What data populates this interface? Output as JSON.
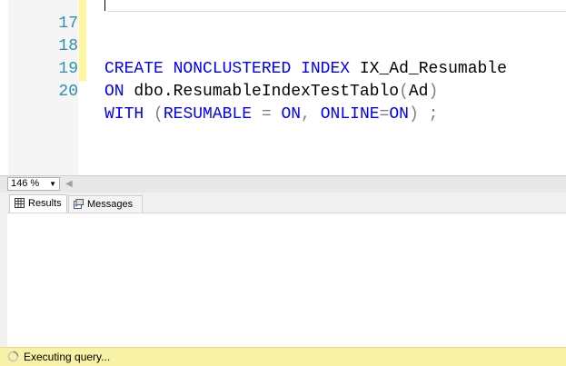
{
  "editor": {
    "lines": [
      {
        "number": "17",
        "tokens": []
      },
      {
        "number": "18",
        "tokens": [
          {
            "t": "CREATE",
            "c": "kw"
          },
          {
            "t": " ",
            "c": "ident"
          },
          {
            "t": "NONCLUSTERED",
            "c": "kw"
          },
          {
            "t": " ",
            "c": "ident"
          },
          {
            "t": "INDEX",
            "c": "kw"
          },
          {
            "t": " IX_Ad_Resumable",
            "c": "ident"
          }
        ]
      },
      {
        "number": "19",
        "tokens": [
          {
            "t": "ON",
            "c": "kw"
          },
          {
            "t": " dbo.ResumableIndexTestTablo",
            "c": "ident"
          },
          {
            "t": "(",
            "c": "op"
          },
          {
            "t": "Ad",
            "c": "ident"
          },
          {
            "t": ")",
            "c": "op"
          }
        ]
      },
      {
        "number": "20",
        "tokens": [
          {
            "t": "WITH",
            "c": "kw"
          },
          {
            "t": " ",
            "c": "ident"
          },
          {
            "t": "(",
            "c": "op"
          },
          {
            "t": "RESUMABLE",
            "c": "kw"
          },
          {
            "t": " ",
            "c": "ident"
          },
          {
            "t": "=",
            "c": "op"
          },
          {
            "t": " ",
            "c": "ident"
          },
          {
            "t": "ON",
            "c": "kw"
          },
          {
            "t": ",",
            "c": "op"
          },
          {
            "t": " ",
            "c": "ident"
          },
          {
            "t": "ONLINE",
            "c": "kw"
          },
          {
            "t": "=",
            "c": "op"
          },
          {
            "t": "ON",
            "c": "kw"
          },
          {
            "t": ")",
            "c": "op"
          },
          {
            "t": " ",
            "c": "ident"
          },
          {
            "t": ";",
            "c": "op"
          }
        ]
      }
    ]
  },
  "zoom": {
    "value": "146 %"
  },
  "tabs": [
    {
      "label": "Results",
      "icon": "grid-icon",
      "active": true
    },
    {
      "label": "Messages",
      "icon": "messages-icon",
      "active": false
    }
  ],
  "status": {
    "text": "Executing query...",
    "icon": "spinner-icon"
  },
  "colors": {
    "keyword": "#0000ff",
    "identifier": "#000000",
    "operator": "#808080",
    "line_number": "#2b91af",
    "change_bar": "#fff59d",
    "status_bar": "#f7f2a5"
  }
}
